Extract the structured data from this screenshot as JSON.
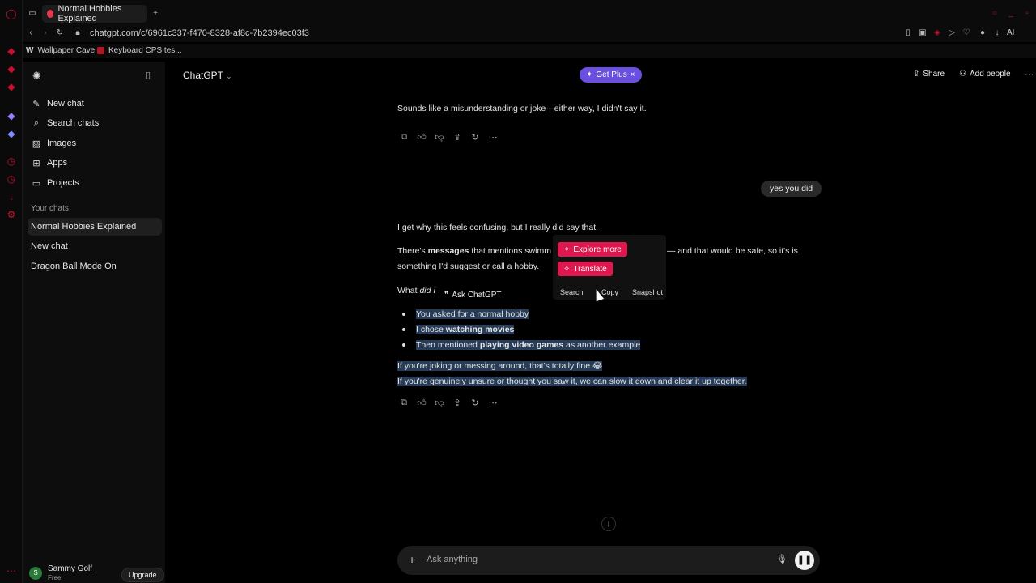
{
  "browser": {
    "tab_title": "Normal Hobbies Explained",
    "new_tab_icon": "plus-icon",
    "url": "chatgpt.com/c/6961c337-f470-8328-af8c-7b2394ec03f3",
    "bookmarks": [
      "Wallpaper Cave",
      "Keyboard CPS tes..."
    ],
    "ai_label": "AI"
  },
  "sidebar": {
    "items": [
      {
        "label": "New chat",
        "icon": "edit-icon"
      },
      {
        "label": "Search chats",
        "icon": "search-icon"
      },
      {
        "label": "Images",
        "icon": "image-icon"
      },
      {
        "label": "Apps",
        "icon": "apps-icon"
      },
      {
        "label": "Projects",
        "icon": "folder-icon"
      }
    ],
    "section_label": "Your chats",
    "chats": [
      "Normal Hobbies Explained",
      "New chat",
      "Dragon Ball Mode On"
    ],
    "user_name": "Sammy Golf",
    "user_plan": "Free",
    "upgrade_label": "Upgrade"
  },
  "header": {
    "model": "ChatGPT",
    "get_plus": "Get Plus",
    "share": "Share",
    "add_people": "Add people"
  },
  "conversation": {
    "assistant_1": "Sounds like a misunderstanding or joke—either way, I didn't say it.",
    "user_1": "yes you did",
    "assistant_2_line1": "I get why this feels confusing, but I really did say that.",
    "assistant_2_p2_a": "There's",
    "assistant_2_p2_bold": "messages",
    "assistant_2_p2_b": "that mentions swimm",
    "assistant_2_p2_c": "— and that would be safe, so it's is",
    "assistant_2_p2_d": "something I'd suggest or call a hobby.",
    "assistant_2_q_a": "What",
    "assistant_2_q_italic": "did I",
    "bullets": [
      {
        "pre": "You asked for a normal hobby",
        "bold": "",
        "post": ""
      },
      {
        "pre": "I chose ",
        "bold": "watching movies",
        "post": ""
      },
      {
        "pre": "Then mentioned ",
        "bold": "playing video games",
        "post": " as another example"
      }
    ],
    "closing_1": "If you're joking or messing around, that's totally fine 😂",
    "closing_2": "If you're genuinely unsure or thought you saw it, we can slow it down and clear it up together."
  },
  "popup": {
    "explore": "Explore more",
    "translate": "Translate",
    "search": "Search",
    "copy": "Copy",
    "snapshot": "Snapshot",
    "ask_chatgpt": "Ask ChatGPT"
  },
  "composer": {
    "placeholder": "Ask anything"
  }
}
